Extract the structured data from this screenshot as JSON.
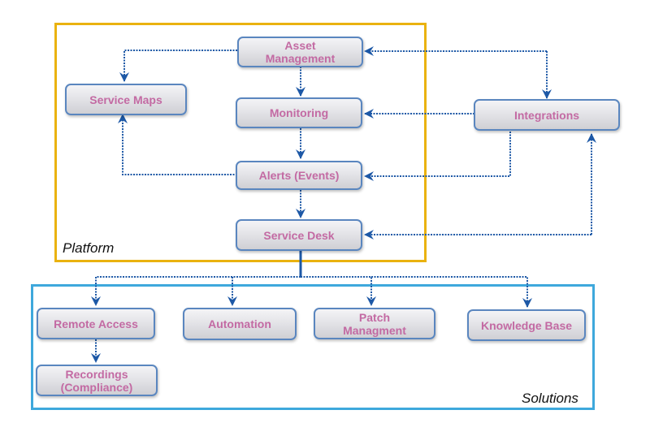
{
  "diagram": {
    "colors": {
      "platform_border": "#eab20f",
      "solutions_border": "#3ea8dc",
      "node_border": "#5a86bf",
      "node_text": "#c36aa3",
      "connector": "#1d58a6"
    },
    "groups": {
      "platform": {
        "label": "Platform"
      },
      "solutions": {
        "label": "Solutions"
      }
    },
    "nodes": {
      "asset_management": {
        "label": "Asset\nManagement"
      },
      "service_maps": {
        "label": "Service Maps"
      },
      "monitoring": {
        "label": "Monitoring"
      },
      "alerts": {
        "label": "Alerts (Events)"
      },
      "service_desk": {
        "label": "Service Desk"
      },
      "integrations": {
        "label": "Integrations"
      },
      "remote_access": {
        "label": "Remote Access"
      },
      "recordings": {
        "label": "Recordings\n(Compliance)"
      },
      "automation": {
        "label": "Automation"
      },
      "patch_management": {
        "label": "Patch\nManagment"
      },
      "knowledge_base": {
        "label": "Knowledge Base"
      }
    },
    "edges": [
      {
        "from": "asset_management",
        "to": "service_maps"
      },
      {
        "from": "asset_management",
        "to": "monitoring"
      },
      {
        "from": "monitoring",
        "to": "alerts"
      },
      {
        "from": "alerts",
        "to": "service_desk"
      },
      {
        "from": "alerts",
        "to": "service_maps"
      },
      {
        "from": "integrations",
        "to": "asset_management"
      },
      {
        "from": "asset_management",
        "to": "integrations"
      },
      {
        "from": "integrations",
        "to": "monitoring"
      },
      {
        "from": "integrations",
        "to": "alerts"
      },
      {
        "from": "integrations",
        "to": "service_desk"
      },
      {
        "from": "service_desk",
        "to": "integrations"
      },
      {
        "from": "service_desk",
        "to": "remote_access"
      },
      {
        "from": "service_desk",
        "to": "automation"
      },
      {
        "from": "service_desk",
        "to": "patch_management"
      },
      {
        "from": "service_desk",
        "to": "knowledge_base"
      },
      {
        "from": "remote_access",
        "to": "recordings"
      }
    ]
  }
}
